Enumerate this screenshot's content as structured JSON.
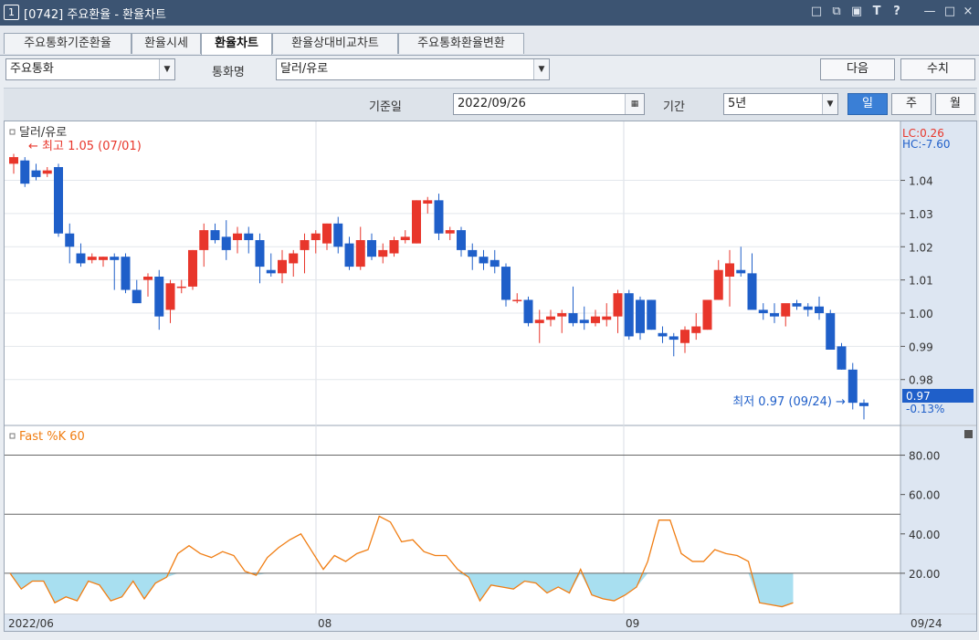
{
  "window": {
    "number": "1",
    "title": "[0742] 주요환율 - 환율차트",
    "icons": [
      "layout-icon",
      "copy-icon",
      "settings-icon",
      "text-icon",
      "help-icon",
      "minimize-icon",
      "maximize-icon",
      "close-icon"
    ],
    "icon_glyphs": [
      "□",
      "⧉",
      "▣",
      "T",
      "?",
      "—",
      "□",
      "×"
    ]
  },
  "tabs": [
    {
      "label": "주요통화기준환율"
    },
    {
      "label": "환율시세"
    },
    {
      "label": "환율차트"
    },
    {
      "label": "환율상대비교차트"
    },
    {
      "label": "주요통화환율변환"
    }
  ],
  "controls": {
    "group_select": "주요통화",
    "currency_label": "통화명",
    "currency_select": "달러/유로",
    "next_button": "다음",
    "value_button": "수치",
    "base_date_label": "기준일",
    "base_date": "2022/09/26",
    "period_label": "기간",
    "period_select": "5년",
    "period_buttons": [
      "일",
      "주",
      "월"
    ]
  },
  "chart_data": [
    {
      "type": "candlestick",
      "title": "달러/유로",
      "annotations": {
        "high": "최고 1.05 (07/01)",
        "low": "최저 0.97 (09/24)",
        "lc": "LC:0.26",
        "hc": "HC:-7.60",
        "current": "0.97",
        "change": "-0.13%"
      },
      "y_ticks": [
        "1.04",
        "1.03",
        "1.02",
        "1.01",
        "1.00",
        "0.99",
        "0.98"
      ],
      "ylim": [
        0.967,
        1.055
      ],
      "candles": [
        [
          1.045,
          1.048,
          1.042,
          1.047
        ],
        [
          1.046,
          1.047,
          1.038,
          1.039
        ],
        [
          1.043,
          1.045,
          1.04,
          1.041
        ],
        [
          1.042,
          1.044,
          1.041,
          1.043
        ],
        [
          1.044,
          1.045,
          1.023,
          1.024
        ],
        [
          1.024,
          1.027,
          1.015,
          1.02
        ],
        [
          1.018,
          1.021,
          1.014,
          1.015
        ],
        [
          1.016,
          1.018,
          1.015,
          1.017
        ],
        [
          1.016,
          1.017,
          1.014,
          1.017
        ],
        [
          1.017,
          1.018,
          1.007,
          1.016
        ],
        [
          1.017,
          1.018,
          1.006,
          1.007
        ],
        [
          1.007,
          1.01,
          1.003,
          1.003
        ],
        [
          1.01,
          1.012,
          1.005,
          1.011
        ],
        [
          1.011,
          1.013,
          0.995,
          0.999
        ],
        [
          1.001,
          1.01,
          0.997,
          1.009
        ],
        [
          1.008,
          1.01,
          1.006,
          1.008
        ],
        [
          1.008,
          1.019,
          1.007,
          1.019
        ],
        [
          1.019,
          1.027,
          1.014,
          1.025
        ],
        [
          1.025,
          1.027,
          1.021,
          1.022
        ],
        [
          1.023,
          1.028,
          1.016,
          1.019
        ],
        [
          1.022,
          1.026,
          1.018,
          1.024
        ],
        [
          1.024,
          1.026,
          1.018,
          1.022
        ],
        [
          1.022,
          1.024,
          1.009,
          1.014
        ],
        [
          1.013,
          1.018,
          1.011,
          1.012
        ],
        [
          1.012,
          1.019,
          1.009,
          1.016
        ],
        [
          1.015,
          1.019,
          1.011,
          1.018
        ],
        [
          1.019,
          1.024,
          1.012,
          1.022
        ],
        [
          1.022,
          1.025,
          1.018,
          1.024
        ],
        [
          1.021,
          1.027,
          1.019,
          1.027
        ],
        [
          1.027,
          1.029,
          1.018,
          1.02
        ],
        [
          1.021,
          1.023,
          1.013,
          1.014
        ],
        [
          1.014,
          1.026,
          1.013,
          1.022
        ],
        [
          1.022,
          1.024,
          1.016,
          1.017
        ],
        [
          1.017,
          1.021,
          1.015,
          1.019
        ],
        [
          1.018,
          1.023,
          1.017,
          1.022
        ],
        [
          1.022,
          1.025,
          1.021,
          1.023
        ],
        [
          1.021,
          1.034,
          1.021,
          1.034
        ],
        [
          1.033,
          1.035,
          1.03,
          1.034
        ],
        [
          1.034,
          1.036,
          1.022,
          1.024
        ],
        [
          1.024,
          1.026,
          1.022,
          1.025
        ],
        [
          1.025,
          1.026,
          1.017,
          1.019
        ],
        [
          1.019,
          1.021,
          1.013,
          1.017
        ],
        [
          1.017,
          1.019,
          1.013,
          1.015
        ],
        [
          1.016,
          1.019,
          1.012,
          1.014
        ],
        [
          1.014,
          1.015,
          1.002,
          1.004
        ],
        [
          1.004,
          1.006,
          1.003,
          1.004
        ],
        [
          1.004,
          1.005,
          0.996,
          0.997
        ],
        [
          0.997,
          1.001,
          0.991,
          0.998
        ],
        [
          0.998,
          1.001,
          0.996,
          0.999
        ],
        [
          0.999,
          1.001,
          0.994,
          1.0
        ],
        [
          1.0,
          1.008,
          0.996,
          0.997
        ],
        [
          0.998,
          1.002,
          0.995,
          0.997
        ],
        [
          0.997,
          1.001,
          0.996,
          0.999
        ],
        [
          0.998,
          1.003,
          0.996,
          0.999
        ],
        [
          0.999,
          1.007,
          0.994,
          1.006
        ],
        [
          1.006,
          1.007,
          0.992,
          0.993
        ],
        [
          1.004,
          1.005,
          0.992,
          0.994
        ],
        [
          1.004,
          1.004,
          0.995,
          0.995
        ],
        [
          0.994,
          0.996,
          0.991,
          0.993
        ],
        [
          0.993,
          0.994,
          0.987,
          0.992
        ],
        [
          0.991,
          0.996,
          0.988,
          0.995
        ],
        [
          0.994,
          1.0,
          0.992,
          0.996
        ],
        [
          0.995,
          1.004,
          0.995,
          1.004
        ],
        [
          1.004,
          1.016,
          1.004,
          1.013
        ],
        [
          1.011,
          1.019,
          1.002,
          1.015
        ],
        [
          1.013,
          1.02,
          1.011,
          1.012
        ],
        [
          1.012,
          1.018,
          1.002,
          1.001
        ],
        [
          1.001,
          1.003,
          0.998,
          1.0
        ],
        [
          1.0,
          1.003,
          0.997,
          0.999
        ],
        [
          0.999,
          1.002,
          0.996,
          1.003
        ],
        [
          1.003,
          1.004,
          1.001,
          1.002
        ],
        [
          1.002,
          1.003,
          0.999,
          1.001
        ],
        [
          1.002,
          1.005,
          0.998,
          1.0
        ],
        [
          1.0,
          1.001,
          0.991,
          0.989
        ],
        [
          0.99,
          0.991,
          0.983,
          0.983
        ],
        [
          0.983,
          0.985,
          0.971,
          0.973
        ],
        [
          0.973,
          0.974,
          0.968,
          0.972
        ]
      ],
      "colors": {
        "up": "#e8362b",
        "down": "#1f5fc9"
      }
    },
    {
      "type": "line",
      "title": "Fast %K 60",
      "y_ticks": [
        "80.00",
        "60.00",
        "40.00",
        "20.00"
      ],
      "ylim": [
        0,
        90
      ],
      "hlines": [
        80,
        20,
        50
      ],
      "values": [
        20,
        12,
        16,
        16,
        5,
        8,
        6,
        16,
        14,
        6,
        8,
        16,
        7,
        15,
        18,
        30,
        34,
        30,
        28,
        31,
        29,
        21,
        19,
        28,
        33,
        37,
        40,
        31,
        22,
        29,
        26,
        30,
        32,
        49,
        46,
        36,
        37,
        31,
        29,
        29,
        22,
        18,
        6,
        14,
        13,
        12,
        16,
        15,
        10,
        13,
        10,
        22,
        9,
        7,
        6,
        9,
        13,
        26,
        47,
        47,
        30,
        26,
        26,
        32,
        30,
        29,
        26,
        5,
        4,
        3,
        5
      ],
      "fill": "#a8dff0",
      "line": "#f07d12"
    }
  ],
  "x_axis": {
    "ticks": [
      "2022/06",
      "08",
      "09",
      "09/24"
    ]
  }
}
